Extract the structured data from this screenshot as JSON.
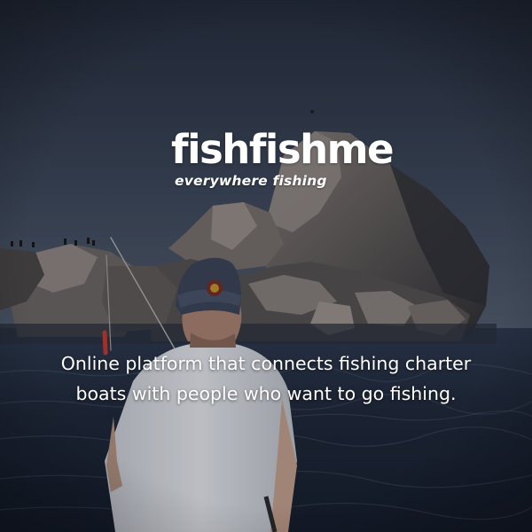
{
  "brand": {
    "name": "fishfishme",
    "tagline": "everywhere fishing"
  },
  "description": {
    "line1": "Online platform that connects fishing charter",
    "line2": "boats with people who want to go fishing."
  },
  "colors": {
    "sky_top": "#252c3a",
    "sky_bottom": "#4f5a6a",
    "sea": "#1c2536",
    "rock": "#6e6a67",
    "cap": "#3c4558",
    "shirt": "#e4e5e8",
    "text": "#ffffff"
  }
}
